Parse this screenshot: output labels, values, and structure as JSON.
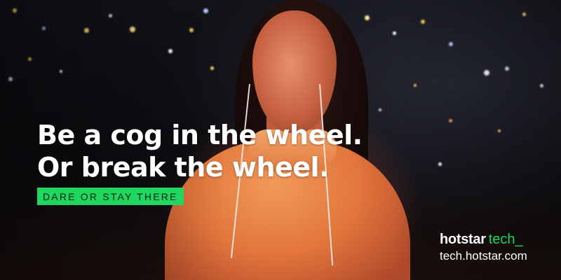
{
  "headline": {
    "line1": "Be a cog in the wheel.",
    "line2": "Or break the wheel."
  },
  "tagline": "DARE OR STAY THERE",
  "brand": {
    "logo_main": "hotstar",
    "logo_sub": "tech",
    "logo_cursor": "_",
    "url": "tech.hotstar.com"
  },
  "colors": {
    "accent": "#1fd65f",
    "headline": "#ffffff",
    "sweater": "#e2753c"
  }
}
